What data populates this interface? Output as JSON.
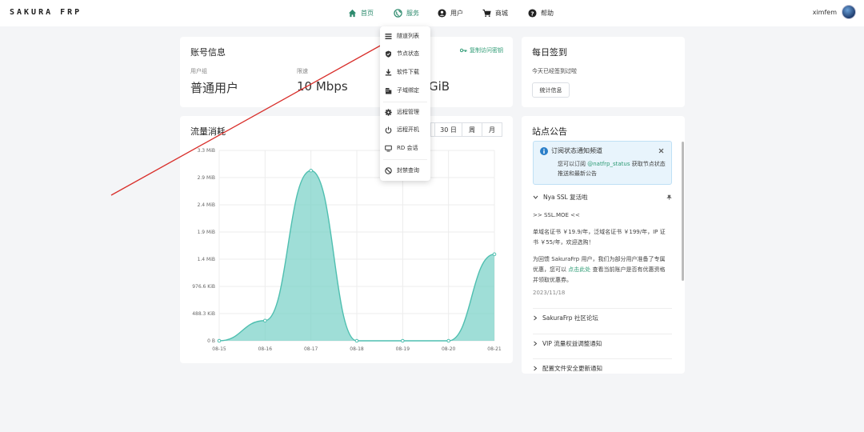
{
  "header": {
    "brand": "SAKURA FRP",
    "nav": [
      {
        "label": "首页",
        "icon": "home-icon",
        "active": true
      },
      {
        "label": "服务",
        "icon": "globe-icon",
        "active": false
      },
      {
        "label": "用户",
        "icon": "user-icon",
        "active": false
      },
      {
        "label": "商城",
        "icon": "cart-icon",
        "active": false
      },
      {
        "label": "帮助",
        "icon": "help-icon",
        "active": false
      }
    ],
    "username": "ximfem"
  },
  "account": {
    "title": "账号信息",
    "copy_link": "复制访问密钥",
    "fields": [
      {
        "label": "用户组",
        "value": "普通用户"
      },
      {
        "label": "限速",
        "value": "10 Mbps"
      },
      {
        "label": "",
        "value": "GiB"
      }
    ]
  },
  "checkin": {
    "title": "每日签到",
    "status": "今天已经签到过啦",
    "button": "统计信息"
  },
  "traffic": {
    "title": "流量消耗",
    "tabs": [
      "30 日",
      "周",
      "月"
    ]
  },
  "chart_data": {
    "type": "area",
    "title": "",
    "xlabel": "",
    "ylabel": "",
    "x": [
      "08-15",
      "08-16",
      "08-17",
      "08-18",
      "08-19",
      "08-20",
      "08-21"
    ],
    "values_mib": [
      0,
      0.35,
      2.95,
      0,
      0,
      0,
      1.5
    ],
    "yticks": [
      "0 B",
      "488.3 KiB",
      "976.6 KiB",
      "1.4 MiB",
      "1.9 MiB",
      "2.4 MiB",
      "2.9 MiB",
      "3.3 MiB"
    ],
    "ylim": [
      0,
      3.3
    ],
    "grid": true,
    "color": "#7fd3c9"
  },
  "dropdown": {
    "items": [
      {
        "label": "隧道列表",
        "icon": "list-icon"
      },
      {
        "label": "节点状态",
        "icon": "shield-icon"
      },
      {
        "label": "软件下载",
        "icon": "download-icon"
      },
      {
        "label": "子域绑定",
        "icon": "building-icon"
      },
      {
        "label": "远程管理",
        "icon": "gear-icon"
      },
      {
        "label": "远程开机",
        "icon": "power-icon"
      },
      {
        "label": "RD 会话",
        "icon": "monitor-icon"
      },
      {
        "label": "封禁查询",
        "icon": "ban-icon"
      }
    ]
  },
  "announcements": {
    "title": "站点公告",
    "notice": {
      "title": "订阅状态通知频道",
      "body_pre": "您可以订阅",
      "body_link": "@natfrp_status",
      "body_post": "获取节点状态推送和最新公告"
    },
    "expanded": {
      "title": "Nya SSL 复活啦",
      "link_line": ">> SSL.MOE <<",
      "p1": "单域名证书 ￥19.9/年，泛域名证书 ￥199/年，IP 证书 ￥55/年，欢迎选购！",
      "p2_pre": "为回馈 SakuraFrp 用户，我们为部分用户准备了专属优惠，您可以",
      "p2_link": "点击此处",
      "p2_post": "查看当前账户是否有优惠资格并领取优惠券。",
      "date": "2023/11/18"
    },
    "collapsed": [
      "SakuraFrp 社区论坛",
      "VIP 流量权益调整通知",
      "配置文件安全更新通知"
    ]
  },
  "colors": {
    "accent": "#2e9b74",
    "annotation_arrow": "#d9302c"
  }
}
